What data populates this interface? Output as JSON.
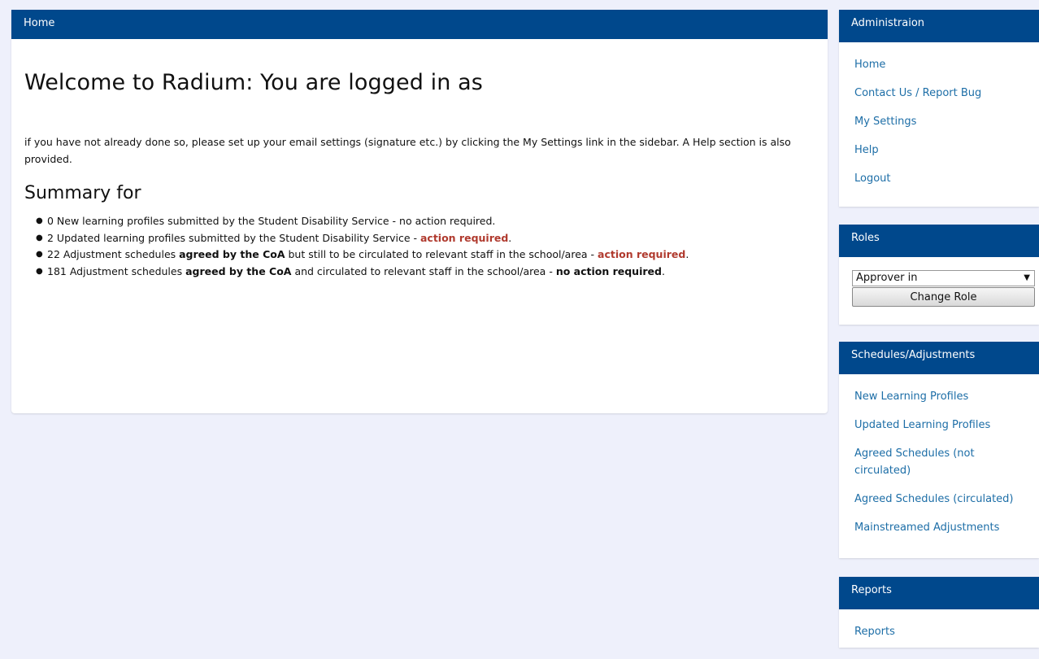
{
  "main": {
    "header": "Home",
    "title": "Welcome to Radium: You are logged in as",
    "intro": "if you have not already done so, please set up your email settings (signature etc.) by clicking the My Settings link in the sidebar. A Help section is also provided.",
    "summary_title": "Summary for",
    "summary": [
      {
        "lead": "0 New learning profiles submitted by the Student Disability Service - no action required."
      },
      {
        "lead": "2 Updated learning profiles submitted by the Student Disability Service - ",
        "action": "action required",
        "tail": "."
      },
      {
        "lead": "22 Adjustment schedules ",
        "bold": "agreed by the CoA",
        "mid": " but still to be circulated to relevant staff in the school/area - ",
        "action": "action required",
        "tail": "."
      },
      {
        "lead": "181 Adjustment schedules ",
        "bold": "agreed by the CoA",
        "mid": " and circulated to relevant staff in the school/area - ",
        "bold2": "no action required",
        "tail": "."
      }
    ]
  },
  "sidebar": {
    "admin": {
      "header": "Administraion",
      "links": [
        "Home",
        "Contact Us / Report Bug",
        "My Settings",
        "Help",
        "Logout"
      ]
    },
    "roles": {
      "header": "Roles",
      "selected": "Approver in",
      "button": "Change Role"
    },
    "schedules": {
      "header": "Schedules/Adjustments",
      "links": [
        "New Learning Profiles",
        "Updated Learning Profiles",
        "Agreed Schedules (not circulated)",
        "Agreed Schedules (circulated)",
        "Mainstreamed Adjustments"
      ]
    },
    "reports": {
      "header": "Reports",
      "links": [
        "Reports"
      ]
    }
  }
}
